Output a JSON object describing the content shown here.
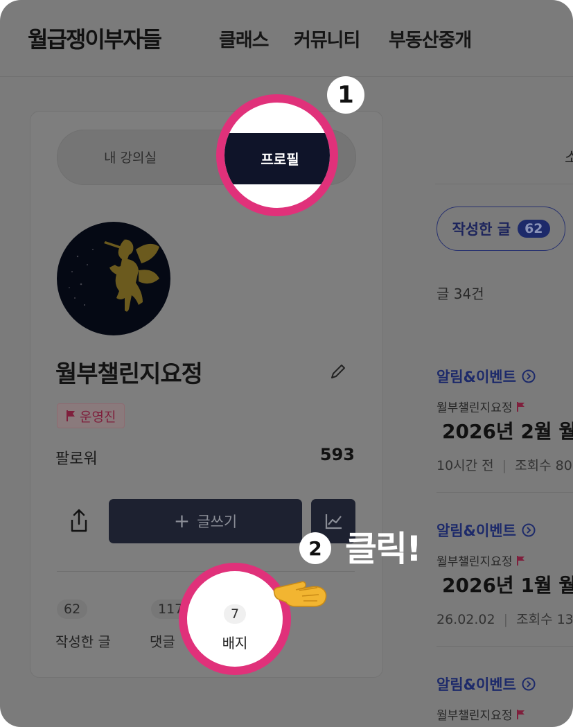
{
  "header": {
    "logo": "월급쟁이부자들",
    "nav": [
      "클래스",
      "커뮤니티",
      "부동산중개"
    ]
  },
  "profile_tabs": {
    "my_classroom": "내 강의실",
    "profile": "프로필"
  },
  "profile": {
    "name": "월부챌린지요정",
    "role_badge": "운영진",
    "follower_label": "팔로워",
    "follower_count": "593",
    "write_button": "글쓰기",
    "stats": [
      {
        "count": "62",
        "label": "작성한 글"
      },
      {
        "count": "117",
        "label": "댓글"
      },
      {
        "count": "7",
        "label": "배지"
      }
    ]
  },
  "right": {
    "tab_cut": "소",
    "written_label": "작성한 글",
    "written_count": "62",
    "post_count_text": "글 34건",
    "posts": [
      {
        "category": "알림&이벤트",
        "author": "월부챌린지요정",
        "title": "2026년 2월 월",
        "meta_time": "10시간 전",
        "meta_views": "조회수 80"
      },
      {
        "category": "알림&이벤트",
        "author": "월부챌린지요정",
        "title": "2026년 1월 월",
        "meta_time": "26.02.02",
        "meta_views": "조회수 13"
      },
      {
        "category": "알림&이벤트",
        "author": "월부챌린지요정"
      }
    ]
  },
  "annotations": {
    "step1": "1",
    "step2": "2",
    "click_text": "클릭!"
  },
  "colors": {
    "accent_ring": "#e0317a",
    "dark_button": "#1d2130",
    "brand_navy": "#1d2a6a"
  }
}
